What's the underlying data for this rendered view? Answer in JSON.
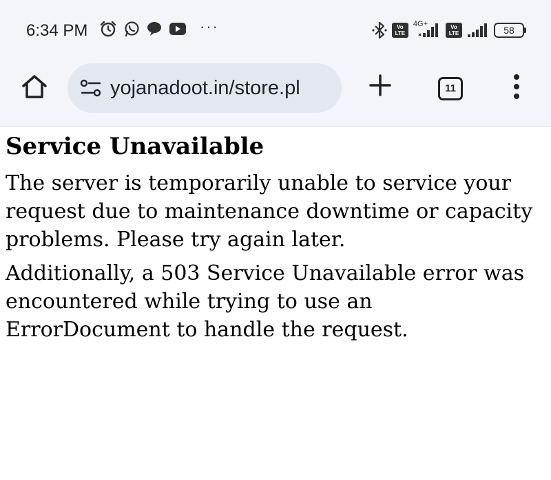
{
  "status_bar": {
    "time": "6:34 PM",
    "left_icons": [
      "alarm-icon",
      "whatsapp-icon",
      "chat-bubble-icon",
      "youtube-icon"
    ],
    "more_indicator": "···",
    "sim1": {
      "volte_line1": "Vo",
      "volte_line2": "LTE",
      "network_type": "4G+"
    },
    "sim2": {
      "volte_line1": "Vo",
      "volte_line2": "LTE"
    },
    "battery": "58"
  },
  "toolbar": {
    "url": "yojanadoot.in/store.pl",
    "tab_count": "11"
  },
  "page": {
    "heading": "Service Unavailable",
    "paragraph1": "The server is temporarily unable to service your request due to maintenance downtime or capacity problems. Please try again later.",
    "paragraph2": "Additionally, a 503 Service Unavailable error was encountered while trying to use an ErrorDocument to handle the request."
  }
}
